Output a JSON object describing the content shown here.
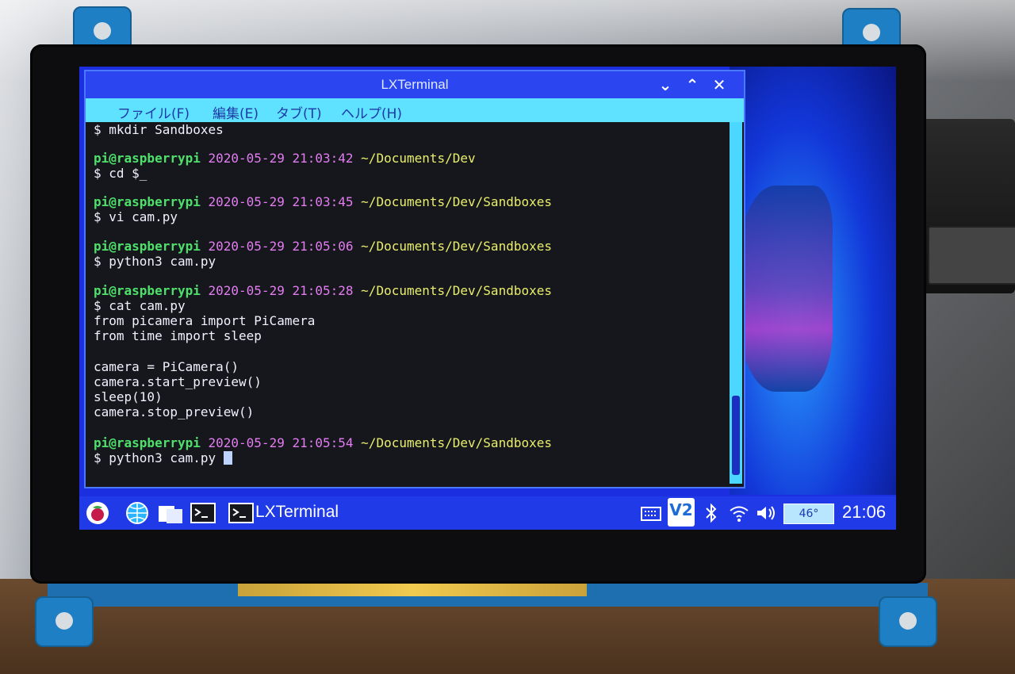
{
  "window": {
    "title": "LXTerminal",
    "controls": {
      "minimize": "⌄",
      "maximize": "⌃",
      "close": "✕"
    }
  },
  "menu": {
    "items": [
      "ファイル(F)",
      "編集(E)",
      "タブ(T)",
      "ヘルプ(H)"
    ]
  },
  "terminal": {
    "lines": [
      {
        "kind": "cmd",
        "text": "$ mkdir Sandboxes"
      },
      {
        "kind": "prompt",
        "user": "pi@raspberrypi",
        "date": "2020-05-29 21:03:42",
        "path": "~/Documents/Dev"
      },
      {
        "kind": "cmd",
        "text": "$ cd $_"
      },
      {
        "kind": "prompt",
        "user": "pi@raspberrypi",
        "date": "2020-05-29 21:03:45",
        "path": "~/Documents/Dev/Sandboxes"
      },
      {
        "kind": "cmd",
        "text": "$ vi cam.py"
      },
      {
        "kind": "prompt",
        "user": "pi@raspberrypi",
        "date": "2020-05-29 21:05:06",
        "path": "~/Documents/Dev/Sandboxes"
      },
      {
        "kind": "cmd",
        "text": "$ python3 cam.py"
      },
      {
        "kind": "prompt",
        "user": "pi@raspberrypi",
        "date": "2020-05-29 21:05:28",
        "path": "~/Documents/Dev/Sandboxes"
      },
      {
        "kind": "cmd",
        "text": "$ cat cam.py"
      },
      {
        "kind": "out",
        "text": "from picamera import PiCamera"
      },
      {
        "kind": "out",
        "text": "from time import sleep"
      },
      {
        "kind": "out",
        "text": "camera = PiCamera()"
      },
      {
        "kind": "out",
        "text": "camera.start_preview()"
      },
      {
        "kind": "out",
        "text": "sleep(10)"
      },
      {
        "kind": "out",
        "text": "camera.stop_preview()"
      },
      {
        "kind": "prompt",
        "user": "pi@raspberrypi",
        "date": "2020-05-29 21:05:54",
        "path": "~/Documents/Dev/Sandboxes"
      },
      {
        "kind": "cmd",
        "text": "$ python3 cam.py"
      }
    ]
  },
  "taskbar": {
    "app_label": "LXTerminal",
    "temperature": "46°",
    "clock": "21:06",
    "icons": [
      "raspberry-menu-icon",
      "web-browser-icon",
      "file-manager-icon",
      "terminal-icon",
      "keyboard-icon",
      "vnc-icon",
      "bluetooth-icon",
      "wifi-icon",
      "volume-icon"
    ],
    "vnc_label": "V2"
  },
  "colors": {
    "titlebar": "#2b46f0",
    "menubar": "#5fe2ff",
    "terminal_bg": "#15171c",
    "prompt_user": "#4ee06a",
    "prompt_date": "#e47cf2",
    "prompt_path": "#e9ee6b",
    "taskbar": "#1f3ae6"
  }
}
